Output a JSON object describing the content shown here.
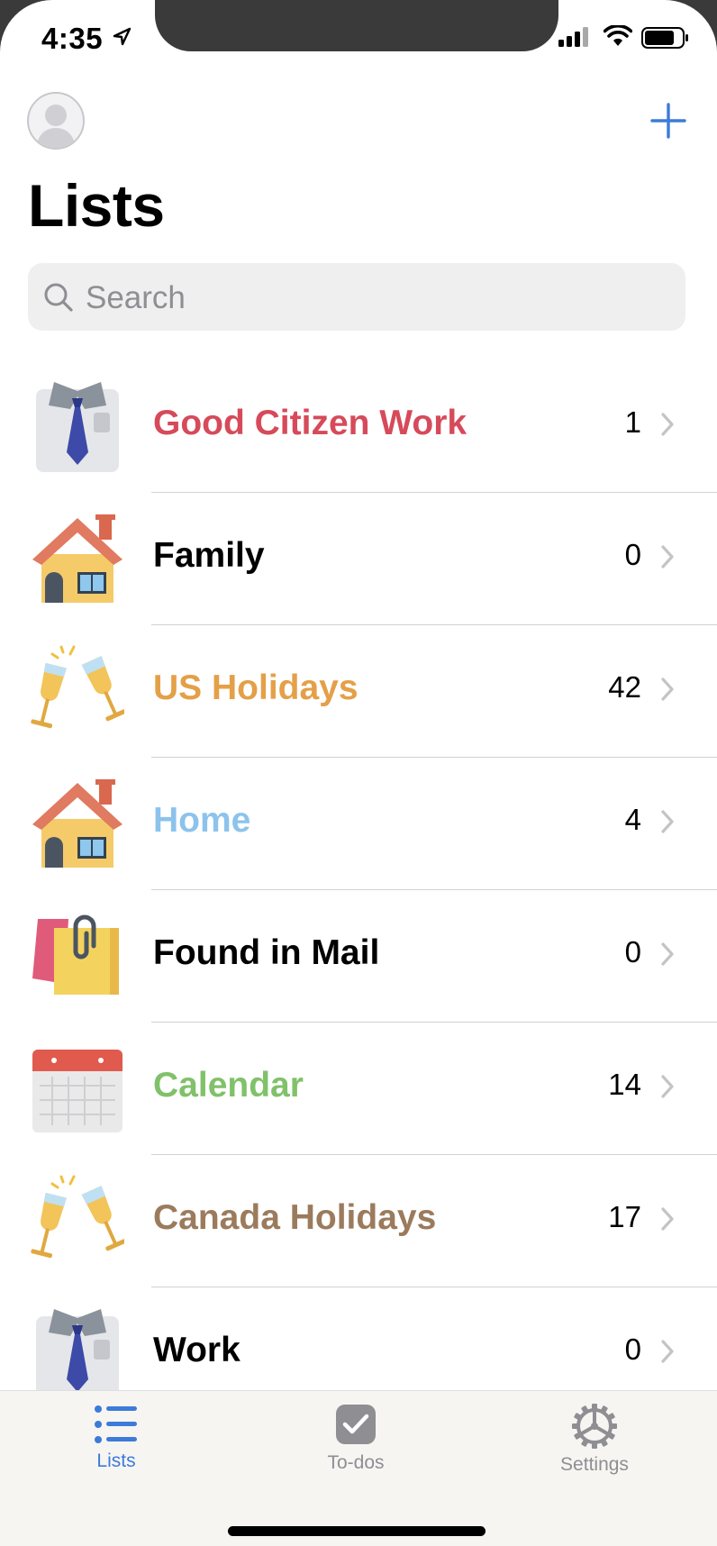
{
  "status_bar": {
    "time": "4:35"
  },
  "header": {
    "title": "Lists"
  },
  "search": {
    "placeholder": "Search"
  },
  "lists": [
    {
      "name": "Good Citizen Work",
      "count": "1",
      "icon": "necktie-icon",
      "color": "#d64a5a"
    },
    {
      "name": "Family",
      "count": "0",
      "icon": "house-icon",
      "color": "#000000"
    },
    {
      "name": "US Holidays",
      "count": "42",
      "icon": "champagne-glasses-icon",
      "color": "#e4a048"
    },
    {
      "name": "Home",
      "count": "4",
      "icon": "house-icon",
      "color": "#8cc3ec"
    },
    {
      "name": "Found in Mail",
      "count": "0",
      "icon": "shopping-bag-icon",
      "color": "#000000"
    },
    {
      "name": "Calendar",
      "count": "14",
      "icon": "calendar-icon",
      "color": "#80c16a"
    },
    {
      "name": "Canada Holidays",
      "count": "17",
      "icon": "champagne-glasses-icon",
      "color": "#9b7b5c"
    },
    {
      "name": "Work",
      "count": "0",
      "icon": "necktie-icon",
      "color": "#000000"
    }
  ],
  "tabbar": {
    "tabs": [
      {
        "label": "Lists",
        "icon": "list-icon",
        "active": true
      },
      {
        "label": "To-dos",
        "icon": "checkmark-icon",
        "active": false
      },
      {
        "label": "Settings",
        "icon": "gear-icon",
        "active": false
      }
    ]
  },
  "colors": {
    "accent": "#3d7bd9",
    "inactive": "#8e8e93"
  }
}
